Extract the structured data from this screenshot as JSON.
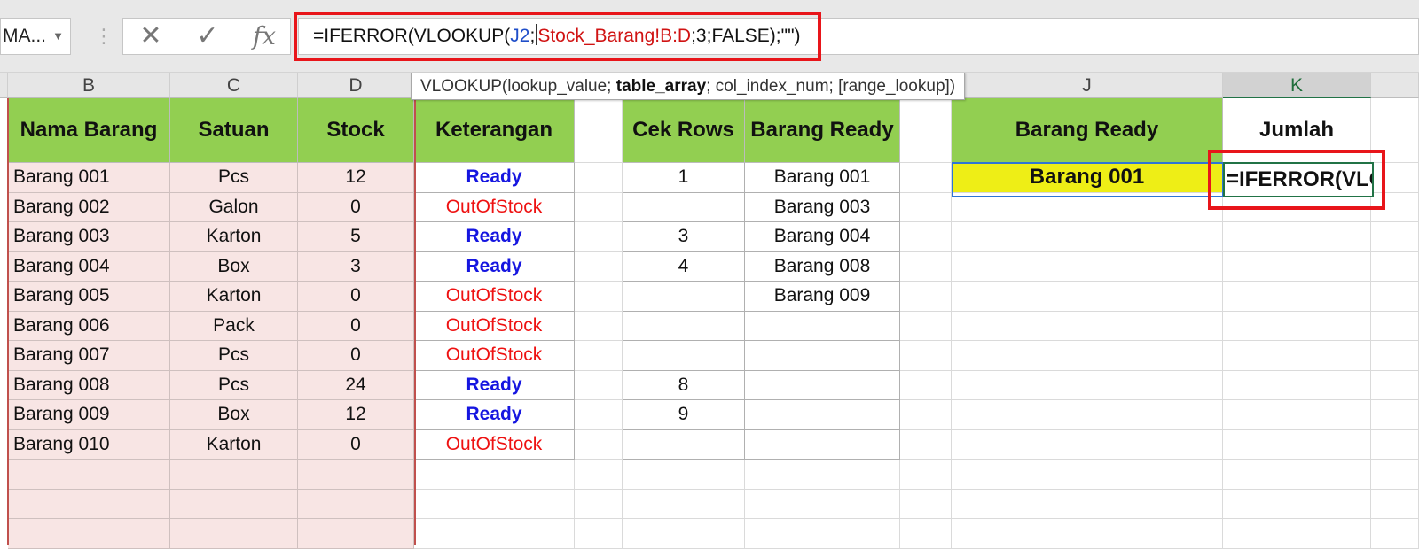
{
  "formula_bar": {
    "name_box": "MA...",
    "formula_prefix": "=IFERROR(VLOOKUP(",
    "formula_ref1": "J2",
    "formula_sep": ";",
    "formula_ref2": "Stock_Barang!B:D",
    "formula_suffix": ";3;FALSE);\"\")"
  },
  "tooltip": {
    "fn": "VLOOKUP(",
    "arg1": "lookup_value; ",
    "arg2_bold": "table_array",
    "rest": "; col_index_num; [range_lookup])"
  },
  "columns": [
    "B",
    "C",
    "D",
    "J",
    "K"
  ],
  "headers": {
    "nama_barang": "Nama Barang",
    "satuan": "Satuan",
    "stock": "Stock",
    "keterangan": "Keterangan",
    "cek_rows": "Cek Rows",
    "barang_ready": "Barang Ready",
    "barang_ready_j": "Barang Ready",
    "jumlah": "Jumlah"
  },
  "rows": [
    {
      "nama": "Barang 001",
      "satuan": "Pcs",
      "stock": "12",
      "ket": "Ready",
      "cek": "1",
      "ready": "Barang 001"
    },
    {
      "nama": "Barang 002",
      "satuan": "Galon",
      "stock": "0",
      "ket": "OutOfStock",
      "cek": "",
      "ready": "Barang 003"
    },
    {
      "nama": "Barang 003",
      "satuan": "Karton",
      "stock": "5",
      "ket": "Ready",
      "cek": "3",
      "ready": "Barang 004"
    },
    {
      "nama": "Barang 004",
      "satuan": "Box",
      "stock": "3",
      "ket": "Ready",
      "cek": "4",
      "ready": "Barang 008"
    },
    {
      "nama": "Barang 005",
      "satuan": "Karton",
      "stock": "0",
      "ket": "OutOfStock",
      "cek": "",
      "ready": "Barang 009"
    },
    {
      "nama": "Barang 006",
      "satuan": "Pack",
      "stock": "0",
      "ket": "OutOfStock",
      "cek": "",
      "ready": ""
    },
    {
      "nama": "Barang 007",
      "satuan": "Pcs",
      "stock": "0",
      "ket": "OutOfStock",
      "cek": "",
      "ready": ""
    },
    {
      "nama": "Barang 008",
      "satuan": "Pcs",
      "stock": "24",
      "ket": "Ready",
      "cek": "8",
      "ready": ""
    },
    {
      "nama": "Barang 009",
      "satuan": "Box",
      "stock": "12",
      "ket": "Ready",
      "cek": "9",
      "ready": ""
    },
    {
      "nama": "Barang 010",
      "satuan": "Karton",
      "stock": "0",
      "ket": "OutOfStock",
      "cek": "",
      "ready": ""
    }
  ],
  "j2_value": "Barang 001",
  "k2_edit": "=IFERROR(VLOOKUP(J2;Stock_Barang!B:D;3;FALSE);\"\")",
  "colors": {
    "header_green": "#92cf51",
    "pink_fill": "#f8e5e4",
    "ready_blue": "#1616e0",
    "oos_red": "#ee1111",
    "j2_yellow": "#eeee16",
    "highlight_red": "#e8151a"
  }
}
